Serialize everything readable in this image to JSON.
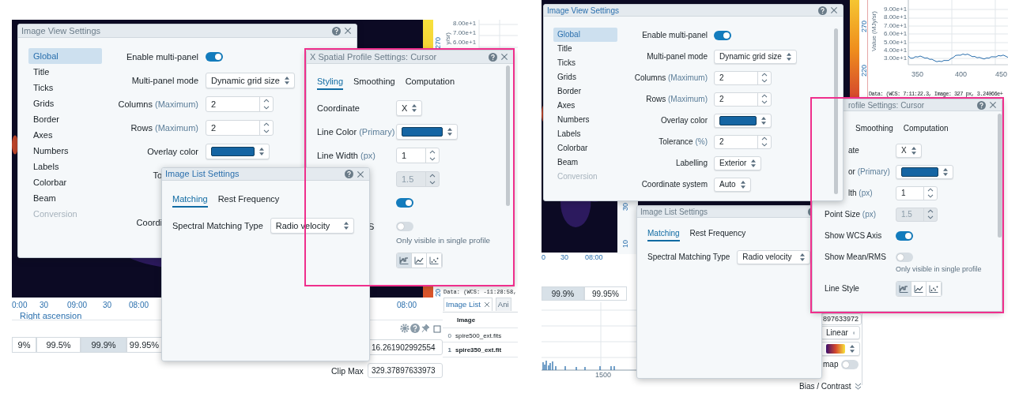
{
  "left_capture": {
    "backdrop": {
      "colorbar_ticks": [
        "270",
        "20"
      ],
      "profile_yticks": [
        "8.00e+1",
        "7.00e+1",
        "6.00e+1"
      ],
      "profile_ylabel": "y/sr)",
      "image_xticks": [
        "0:00",
        "30",
        "09:00",
        "30",
        "08:00"
      ],
      "image2_xticks": [
        "08:00"
      ],
      "xlabel": "Right ascension",
      "percentiles": [
        {
          "label": "9%",
          "selected": false
        },
        {
          "label": "99.5%",
          "selected": false
        },
        {
          "label": "99.9%",
          "selected": true
        },
        {
          "label": "99.95%",
          "selected": false
        }
      ],
      "clip_min": "16.261902992554",
      "clip_max_label": "Clip Max",
      "clip_max": "329.37897633973",
      "cursor_info": "Data: (WCS: -11:28:58,",
      "dock_tabs": [
        {
          "label": "Image List",
          "selected": true,
          "closable": true
        },
        {
          "label": "Ani",
          "selected": false,
          "closable": false
        }
      ],
      "image_list": {
        "columns": [
          "Image"
        ],
        "rows": [
          {
            "index": "0",
            "file": "spire500_ext.fits",
            "selected": false
          },
          {
            "index": "1",
            "file": "spire350_ext.fit",
            "selected": true
          }
        ]
      }
    },
    "image_view": {
      "title": "Image View Settings",
      "active": false,
      "help": true,
      "closable": true,
      "nav": [
        {
          "label": "Global",
          "selected": true,
          "disabled": false
        },
        {
          "label": "Title",
          "selected": false,
          "disabled": false
        },
        {
          "label": "Ticks",
          "selected": false,
          "disabled": false
        },
        {
          "label": "Grids",
          "selected": false,
          "disabled": false
        },
        {
          "label": "Border",
          "selected": false,
          "disabled": false
        },
        {
          "label": "Axes",
          "selected": false,
          "disabled": false
        },
        {
          "label": "Numbers",
          "selected": false,
          "disabled": false
        },
        {
          "label": "Labels",
          "selected": false,
          "disabled": false
        },
        {
          "label": "Colorbar",
          "selected": false,
          "disabled": false
        },
        {
          "label": "Beam",
          "selected": false,
          "disabled": false
        },
        {
          "label": "Conversion",
          "selected": false,
          "disabled": true
        }
      ],
      "rows": [
        {
          "kind": "toggle",
          "label": "Enable multi-panel",
          "on": true
        },
        {
          "kind": "select",
          "label": "Multi-panel mode",
          "value": "Dynamic grid size"
        },
        {
          "kind": "number",
          "label": "Columns",
          "unit": "(Maximum)",
          "value": "2",
          "disabled": false
        },
        {
          "kind": "number",
          "label": "Rows",
          "unit": "(Maximum)",
          "value": "2",
          "disabled": false
        },
        {
          "kind": "color",
          "label": "Overlay color",
          "color": "#1565a3"
        },
        {
          "kind": "label",
          "label": "To",
          "cut": true
        },
        {
          "kind": "label",
          "label": "Coordi",
          "cut": true
        }
      ]
    },
    "spatial_profile": {
      "title": "X Spatial Profile Settings: Cursor",
      "active": false,
      "help": true,
      "closable": true,
      "tabs": [
        {
          "label": "Styling",
          "selected": true
        },
        {
          "label": "Smoothing",
          "selected": false
        },
        {
          "label": "Computation",
          "selected": false
        }
      ],
      "rows": [
        {
          "kind": "select",
          "label": "Coordinate",
          "value": "X"
        },
        {
          "kind": "color",
          "label": "Line Color",
          "unit": "(Primary)",
          "color": "#1565a3"
        },
        {
          "kind": "number",
          "label": "Line Width",
          "unit": "(px)",
          "value": "1",
          "disabled": false
        },
        {
          "kind": "number",
          "value": "1.5",
          "disabled": true
        },
        {
          "kind": "toggle",
          "on": true
        },
        {
          "kind": "toggle",
          "label": "S",
          "cut": true,
          "on": false,
          "hint": "Only visible in single profile"
        },
        {
          "kind": "line_style",
          "options": [
            {
              "kind": "steps",
              "selected": true
            },
            {
              "kind": "line",
              "selected": false
            },
            {
              "kind": "points",
              "selected": false
            }
          ]
        }
      ]
    },
    "image_list": {
      "title": "Image List Settings",
      "active": true,
      "help": true,
      "closable": true,
      "tabs": [
        {
          "label": "Matching",
          "selected": true
        },
        {
          "label": "Rest Frequency",
          "selected": false
        }
      ],
      "rows": [
        {
          "kind": "select",
          "label": "Spectral Matching Type",
          "value": "Radio velocity"
        }
      ]
    }
  },
  "right_capture": {
    "backdrop": {
      "colorbar_ticks": [
        "270",
        "220"
      ],
      "profile_ylabel": "Value (MJy/sr)",
      "profile_yticks": [
        "9.00e+1",
        "8.00e+1",
        "7.00e+1",
        "6.00e+1",
        "5.00e+1",
        "4.00e+1",
        "3.00e+1"
      ],
      "profile_xticks": [
        "350",
        "400",
        "450"
      ],
      "cursor_info": "Data: (WCS: 7:11:22.3, Image: 327 px, 3.24066e+",
      "image_yticks": [
        "30",
        "10"
      ],
      "image_xticks": [
        "0",
        "30",
        "08:00"
      ],
      "percentiles": [
        {
          "label": "99.9%",
          "selected": true
        },
        {
          "label": "99.95%",
          "selected": false
        }
      ],
      "histogram_xticks": [
        "1500"
      ],
      "clip_max": "897633972",
      "scaling": "Linear",
      "invert": {
        "label": "map",
        "on": false
      },
      "bias_contrast": "Bias / Contrast"
    },
    "image_view": {
      "title": "Image View Settings",
      "active": true,
      "help": true,
      "closable": true,
      "nav": [
        {
          "label": "Global",
          "selected": true,
          "disabled": false
        },
        {
          "label": "Title",
          "selected": false,
          "disabled": false
        },
        {
          "label": "Ticks",
          "selected": false,
          "disabled": false
        },
        {
          "label": "Grids",
          "selected": false,
          "disabled": false
        },
        {
          "label": "Border",
          "selected": false,
          "disabled": false
        },
        {
          "label": "Axes",
          "selected": false,
          "disabled": false
        },
        {
          "label": "Numbers",
          "selected": false,
          "disabled": false
        },
        {
          "label": "Labels",
          "selected": false,
          "disabled": false
        },
        {
          "label": "Colorbar",
          "selected": false,
          "disabled": false
        },
        {
          "label": "Beam",
          "selected": false,
          "disabled": false
        },
        {
          "label": "Conversion",
          "selected": false,
          "disabled": true
        }
      ],
      "rows": [
        {
          "kind": "toggle",
          "label": "Enable multi-panel",
          "on": true
        },
        {
          "kind": "select",
          "label": "Multi-panel mode",
          "value": "Dynamic grid size"
        },
        {
          "kind": "number",
          "label": "Columns",
          "unit": "(Maximum)",
          "value": "2",
          "disabled": false
        },
        {
          "kind": "number",
          "label": "Rows",
          "unit": "(Maximum)",
          "value": "2",
          "disabled": false
        },
        {
          "kind": "color",
          "label": "Overlay color",
          "color": "#1565a3"
        },
        {
          "kind": "number",
          "label": "Tolerance",
          "unit": "(%)",
          "value": "2",
          "disabled": false
        },
        {
          "kind": "select",
          "label": "Labelling",
          "value": "Exterior"
        },
        {
          "kind": "select",
          "label": "Coordinate system",
          "value": "Auto"
        }
      ]
    },
    "spatial_profile": {
      "title": "rofile Settings: Cursor",
      "active": false,
      "help": true,
      "closable": true,
      "tabs": [
        {
          "label": "Smoothing",
          "selected": false
        },
        {
          "label": "Computation",
          "selected": false
        }
      ],
      "rows": [
        {
          "kind": "select",
          "label": "ate",
          "cut": true,
          "value": "X"
        },
        {
          "kind": "color",
          "label": "or",
          "unit": "(Primary)",
          "cut": true,
          "color": "#1565a3"
        },
        {
          "kind": "number",
          "label": "lth",
          "unit": "(px)",
          "cut": true,
          "value": "1",
          "disabled": false
        },
        {
          "kind": "number",
          "label": "Point Size",
          "unit": "(px)",
          "value": "1.5",
          "disabled": true
        },
        {
          "kind": "toggle",
          "label": "Show WCS Axis",
          "on": true
        },
        {
          "kind": "toggle",
          "label": "Show Mean/RMS",
          "on": false,
          "hint": "Only visible in single profile"
        },
        {
          "kind": "line_style",
          "label": "Line Style",
          "options": [
            {
              "kind": "steps",
              "selected": true
            },
            {
              "kind": "line",
              "selected": false
            },
            {
              "kind": "points",
              "selected": false
            }
          ]
        }
      ]
    },
    "image_list": {
      "title": "Image List Settings",
      "active": false,
      "help": true,
      "closable": false,
      "tabs": [
        {
          "label": "Matching",
          "selected": true
        },
        {
          "label": "Rest Frequency",
          "selected": false
        }
      ],
      "rows": [
        {
          "kind": "select",
          "label": "Spectral Matching Type",
          "value": "Radio velocity"
        }
      ]
    }
  }
}
